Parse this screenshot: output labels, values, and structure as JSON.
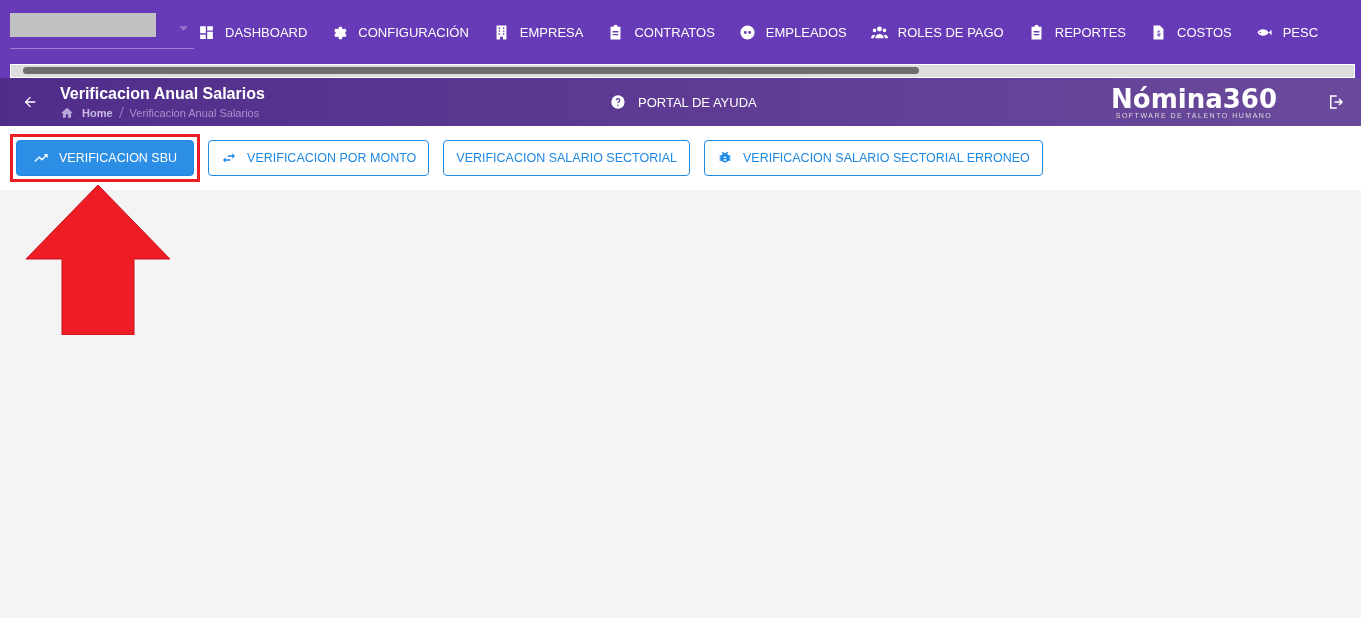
{
  "nav": [
    {
      "label": "DASHBOARD",
      "kind": "dashboard"
    },
    {
      "label": "CONFIGURACIÓN",
      "kind": "gear"
    },
    {
      "label": "EMPRESA",
      "kind": "building"
    },
    {
      "label": "CONTRATOS",
      "kind": "clipboard"
    },
    {
      "label": "EMPLEADOS",
      "kind": "face"
    },
    {
      "label": "ROLES DE PAGO",
      "kind": "people"
    },
    {
      "label": "REPORTES",
      "kind": "clipboard"
    },
    {
      "label": "COSTOS",
      "kind": "invoice"
    },
    {
      "label": "PESC",
      "kind": "fish"
    }
  ],
  "header": {
    "title": "Verificacion Anual Salarios",
    "breadcrumb": [
      "Home",
      "Verificacion Anual Salarios"
    ],
    "help": "PORTAL DE AYUDA",
    "logo": "Nómina360",
    "tagline": "SOFTWARE DE TALENTO HUMANO"
  },
  "actions": [
    {
      "label": "VERIFICACION SBU",
      "kind": "trend",
      "selected": true
    },
    {
      "label": "VERIFICACION POR MONTO",
      "kind": "swap",
      "selected": false
    },
    {
      "label": "VERIFICACION SALARIO SECTORIAL",
      "kind": "plain",
      "selected": false
    },
    {
      "label": "VERIFICACION SALARIO SECTORIAL ERRONEO",
      "kind": "bug",
      "selected": false
    }
  ]
}
